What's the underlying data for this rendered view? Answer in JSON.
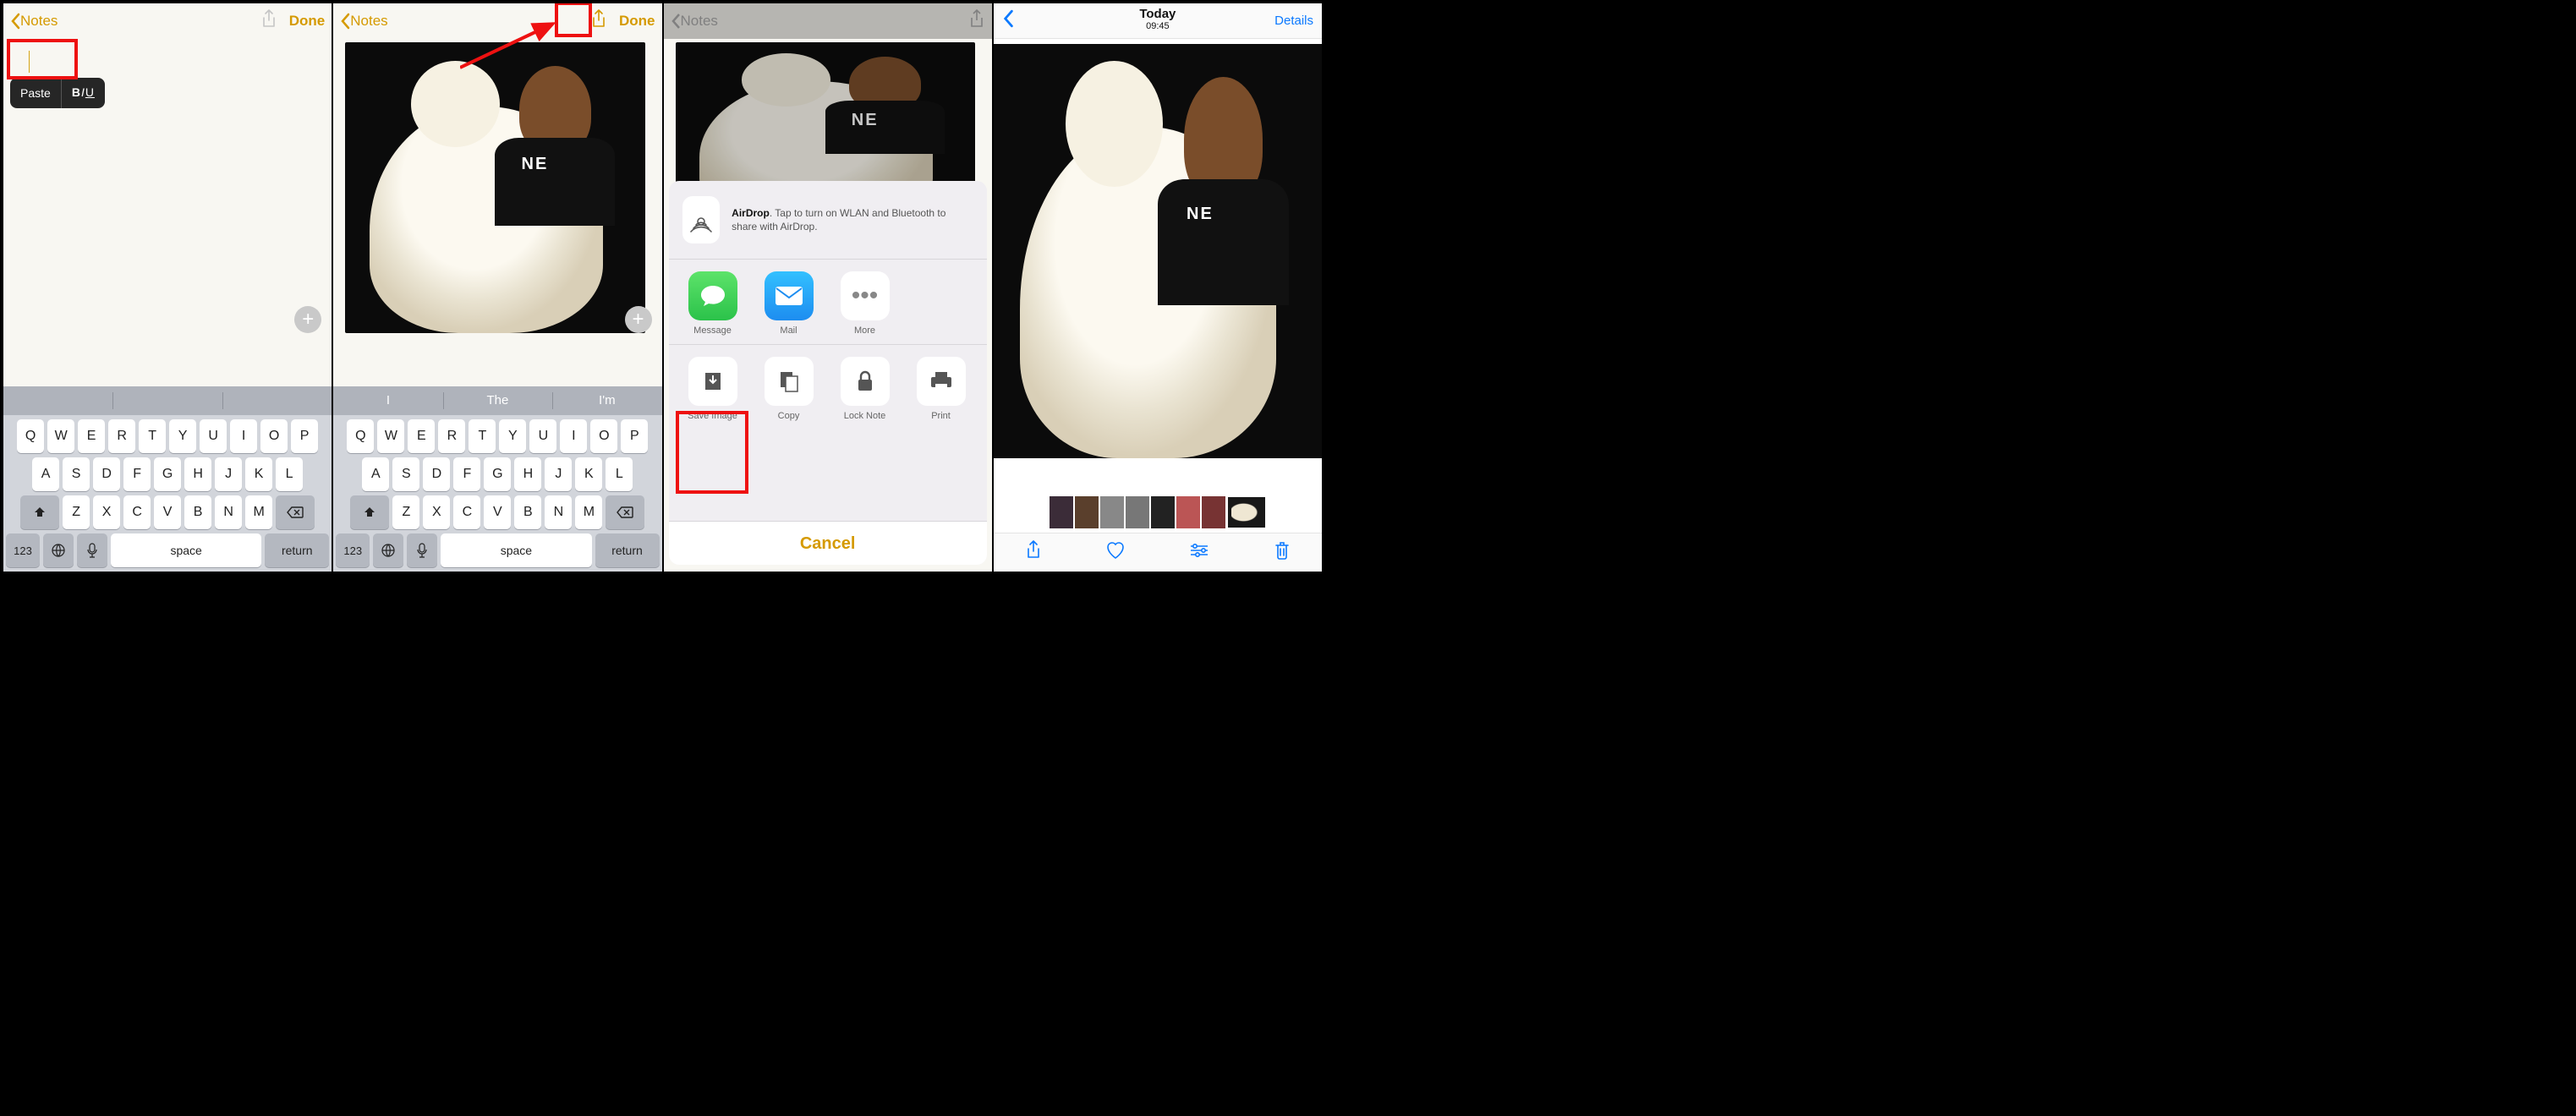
{
  "panel1": {
    "back_label": "Notes",
    "done": "Done",
    "menu": {
      "paste": "Paste",
      "biu": "BIU"
    }
  },
  "panel2": {
    "back_label": "Notes",
    "done": "Done",
    "suggestions": [
      "I",
      "The",
      "I'm"
    ]
  },
  "keyboard": {
    "row1": [
      "Q",
      "W",
      "E",
      "R",
      "T",
      "Y",
      "U",
      "I",
      "O",
      "P"
    ],
    "row2": [
      "A",
      "S",
      "D",
      "F",
      "G",
      "H",
      "J",
      "K",
      "L"
    ],
    "row3": [
      "Z",
      "X",
      "C",
      "V",
      "B",
      "N",
      "M"
    ],
    "k123": "123",
    "space": "space",
    "return": "return"
  },
  "panel3": {
    "back_label": "Notes",
    "airdrop_bold": "AirDrop",
    "airdrop_rest": ". Tap to turn on WLAN and Bluetooth to share with AirDrop.",
    "apps": [
      {
        "label": "Message"
      },
      {
        "label": "Mail"
      },
      {
        "label": "More"
      }
    ],
    "actions": [
      {
        "label": "Save Image"
      },
      {
        "label": "Copy"
      },
      {
        "label": "Lock Note"
      },
      {
        "label": "Print"
      }
    ],
    "cancel": "Cancel"
  },
  "panel4": {
    "title": "Today",
    "time": "09:45",
    "details": "Details"
  }
}
